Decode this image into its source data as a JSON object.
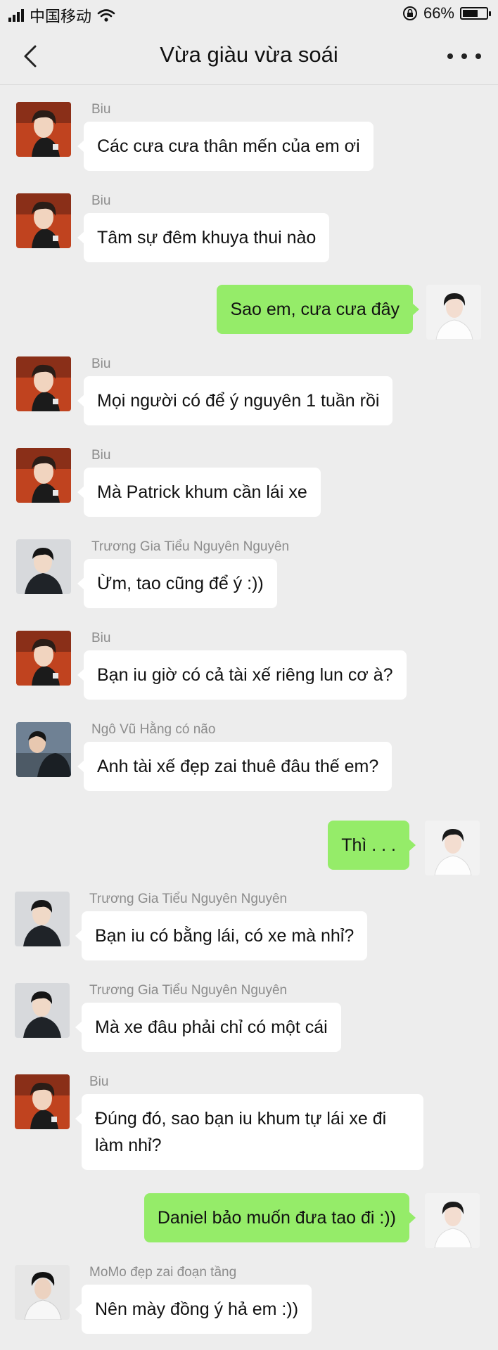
{
  "status": {
    "carrier": "中国移动",
    "battery": "66%",
    "battery_level": 0.66
  },
  "header": {
    "title": "Vừa giàu vừa soái"
  },
  "colors": {
    "background": "#ededed",
    "outgoing_bubble": "#95ec69",
    "incoming_bubble": "#ffffff",
    "sender_name": "#8c8c8c"
  },
  "messages": [
    {
      "sender": "Biu",
      "text": "Các cưa cưa thân mến của em ơi"
    },
    {
      "sender": "Biu",
      "text": "Tâm sự đêm khuya thui nào"
    },
    {
      "text": "Sao em, cưa cưa đây"
    },
    {
      "sender": "Biu",
      "text": "Mọi người có để ý nguyên 1 tuần rồi"
    },
    {
      "sender": "Biu",
      "text": "Mà Patrick khum cần lái xe"
    },
    {
      "sender": "Trương Gia Tiểu Nguyên Nguyên",
      "text": "Ừm, tao cũng để ý :))"
    },
    {
      "sender": "Biu",
      "text": "Bạn iu giờ có cả tài xế riêng lun cơ à?"
    },
    {
      "sender": "Ngô Vũ Hằng có não",
      "text": "Anh tài xế đẹp zai thuê đâu thế em?"
    },
    {
      "text": "Thì . . ."
    },
    {
      "sender": "Trương Gia Tiểu Nguyên Nguyên",
      "text": "Bạn iu có bằng lái, có xe mà nhỉ?"
    },
    {
      "sender": "Trương Gia Tiểu Nguyên Nguyên",
      "text": "Mà xe đâu phải chỉ có một cái"
    },
    {
      "sender": "Biu",
      "text": "Đúng đó, sao bạn iu khum tự lái xe đi làm nhỉ?"
    },
    {
      "text": "Daniel bảo muốn đưa tao đi :))"
    },
    {
      "sender": "MoMo đẹp zai đoạn tầng",
      "text": "Nên mày đồng ý hả em :))"
    }
  ]
}
